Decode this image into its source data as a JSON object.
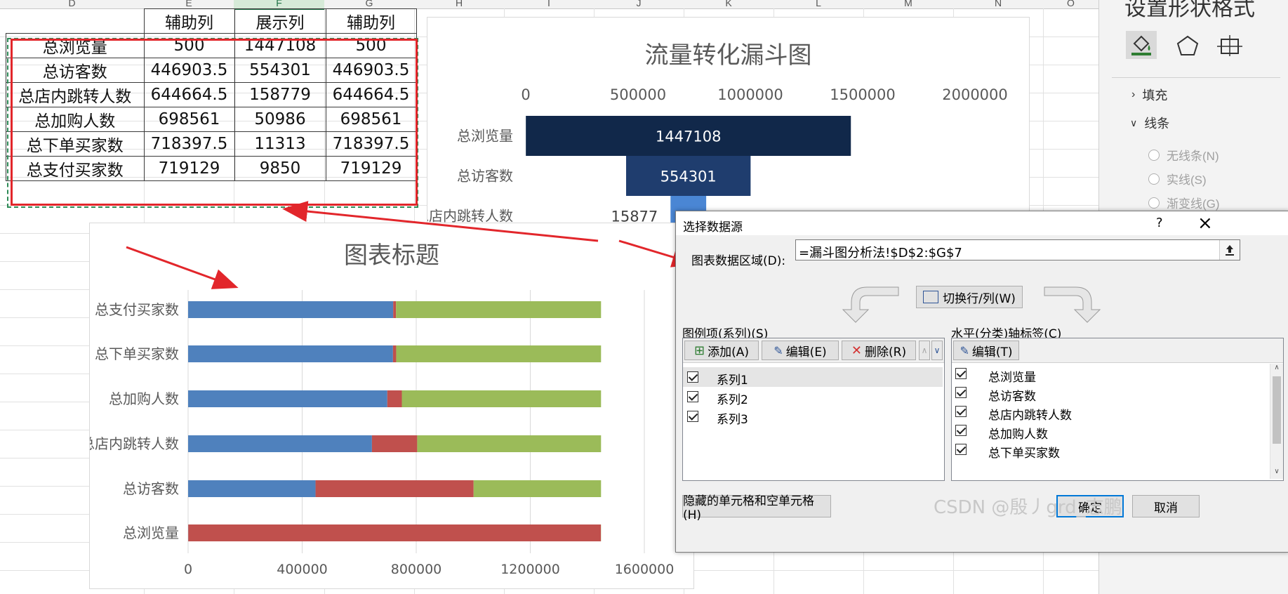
{
  "sheet": {
    "col_headers": [
      "D",
      "E",
      "F",
      "G",
      "H",
      "I",
      "J",
      "K",
      "L",
      "M",
      "N",
      "O"
    ],
    "table": {
      "headers": [
        "",
        "辅助列",
        "展示列",
        "辅助列"
      ],
      "rows": [
        [
          "总浏览量",
          "500",
          "1447108",
          "500"
        ],
        [
          "总访客数",
          "446903.5",
          "554301",
          "446903.5"
        ],
        [
          "总店内跳转人数",
          "644664.5",
          "158779",
          "644664.5"
        ],
        [
          "总加购人数",
          "698561",
          "50986",
          "698561"
        ],
        [
          "总下单买家数",
          "718397.5",
          "11313",
          "718397.5"
        ],
        [
          "总支付买家数",
          "719129",
          "9850",
          "719129"
        ]
      ]
    }
  },
  "chart_data": [
    {
      "type": "bar",
      "title": "流量转化漏斗图",
      "categories": [
        "总浏览量",
        "总访客数",
        "总店内跳转人数"
      ],
      "values": [
        1447108,
        554301,
        158779
      ],
      "value_labels": [
        "1447108",
        "554301",
        "15877"
      ],
      "offsets": [
        500,
        446903.5,
        644664.5
      ],
      "xlim": [
        0,
        2000000
      ],
      "xticks": [
        "0",
        "500000",
        "1000000",
        "1500000",
        "2000000"
      ],
      "colors": [
        "#11284a",
        "#1f3d6e",
        "#4a86d4"
      ]
    },
    {
      "type": "bar",
      "title": "图表标题",
      "stacked": true,
      "categories": [
        "总支付买家数",
        "总下单买家数",
        "总加购人数",
        "总店内跳转人数",
        "总访客数",
        "总浏览量"
      ],
      "series": [
        {
          "name": "系列1",
          "values": [
            719129,
            718397.5,
            698561,
            644664.5,
            446903.5,
            500
          ],
          "color": "#4f81bd"
        },
        {
          "name": "系列2",
          "values": [
            9850,
            11313,
            50986,
            158779,
            554301,
            1447108
          ],
          "color": "#c0504d"
        },
        {
          "name": "系列3",
          "values": [
            719129,
            718397.5,
            698561,
            644664.5,
            446903.5,
            500
          ],
          "color": "#9bbb59"
        }
      ],
      "xlim": [
        0,
        1600000
      ],
      "xticks": [
        "0",
        "400000",
        "800000",
        "1200000",
        "1600000"
      ]
    }
  ],
  "pane": {
    "title": "设置形状格式",
    "fill": "填充",
    "line": "线条",
    "options": [
      "无线条(N)",
      "实线(S)",
      "渐变线(G)"
    ]
  },
  "dialog": {
    "title": "选择数据源",
    "help": "?",
    "close": "×",
    "range_label": "图表数据区域(D):",
    "range_value": "=漏斗图分析法!$D$2:$G$7",
    "switch_label": "切换行/列(W)",
    "legend_label": "图例项(系列)(S)",
    "axis_label": "水平(分类)轴标签(C)",
    "add": "添加(A)",
    "edit": "编辑(E)",
    "delete": "删除(R)",
    "edit_axis": "编辑(T)",
    "series": [
      "系列1",
      "系列2",
      "系列3"
    ],
    "categories": [
      "总浏览量",
      "总访客数",
      "总店内跳转人数",
      "总加购人数",
      "总下单买家数"
    ],
    "hidden_cells": "隐藏的单元格和空单元格(H)",
    "ok": "确定",
    "cancel": "取消"
  },
  "watermark": "CSDN @殷丿grd_志鹏"
}
